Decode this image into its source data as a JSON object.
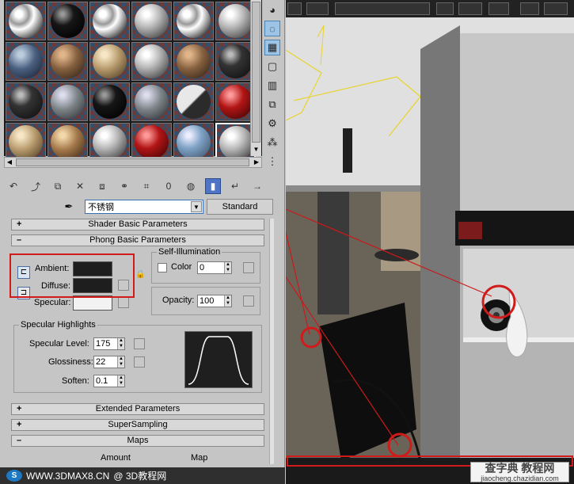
{
  "material_name": "不锈钢",
  "material_type_button": "Standard",
  "material_id_value": "0",
  "rollouts": {
    "shader_basic": "Shader Basic Parameters",
    "phong_basic": "Phong Basic Parameters",
    "extended": "Extended Parameters",
    "supersampling": "SuperSampling",
    "maps": "Maps"
  },
  "phong": {
    "ambient_label": "Ambient:",
    "diffuse_label": "Diffuse:",
    "specular_label": "Specular:",
    "self_illum_title": "Self-Illumination",
    "color_label": "Color",
    "color_value": "0",
    "opacity_label": "Opacity:",
    "opacity_value": "100"
  },
  "specular_highlights": {
    "title": "Specular Highlights",
    "level_label": "Specular Level:",
    "level_value": "175",
    "glossiness_label": "Glossiness:",
    "glossiness_value": "22",
    "soften_label": "Soften:",
    "soften_value": "0.1"
  },
  "maps_header": {
    "amount": "Amount",
    "map": "Map"
  },
  "footer": {
    "logo_text": "S",
    "site": "WWW.3DMAX8.CN",
    "handle": "@ 3D教程网"
  },
  "watermark": {
    "line1": "查字典 教程网",
    "line2": "jiaocheng.chazidian.com"
  },
  "icons": {
    "pick": "eyedropper-icon",
    "lock": "lock-icon"
  }
}
